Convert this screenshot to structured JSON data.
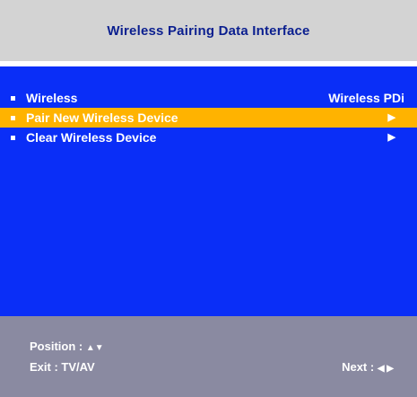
{
  "header": {
    "title": "Wireless Pairing Data Interface"
  },
  "menu": {
    "items": [
      {
        "label": "Wireless",
        "value": "Wireless PDi",
        "selected": false
      },
      {
        "label": "Pair New Wireless Device",
        "arrow": "▶",
        "selected": true
      },
      {
        "label": "Clear Wireless Device",
        "arrow": "▶",
        "selected": false
      }
    ]
  },
  "footer": {
    "position_label": "Position :",
    "position_glyphs": "▲▼",
    "exit_label": "Exit : TV/AV",
    "next_label": "Next :",
    "next_glyphs": "◀ ▶"
  },
  "colors": {
    "header_bg": "#d3d3d3",
    "header_text": "#0b1f8f",
    "menu_bg": "#0a2ef7",
    "highlight": "#ffb300",
    "footer_bg": "#8a8aa1",
    "text": "#ffffff"
  },
  "icons": {
    "bullet": "square-bullet-icon",
    "arrow": "right-triangle-icon",
    "position_glyphs": "up-down-arrows-icon",
    "next_glyphs": "left-right-arrows-icon"
  }
}
